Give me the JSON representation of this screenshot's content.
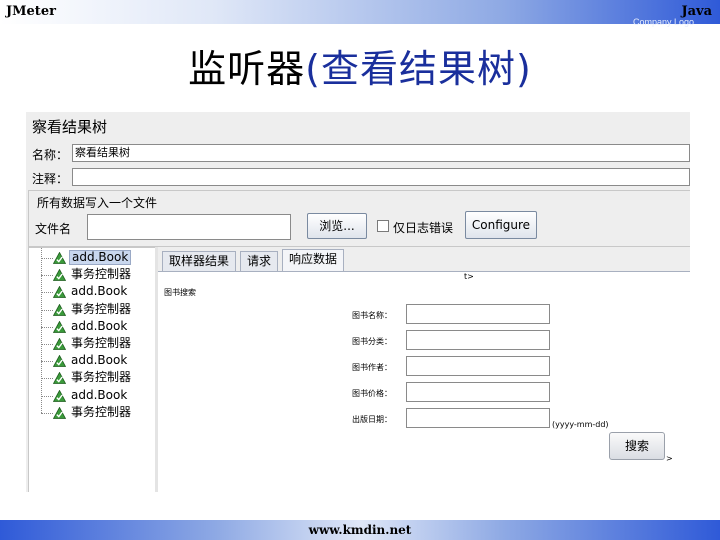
{
  "slide": {
    "header_left": "JMeter",
    "header_right": "Java",
    "header_logo": "Company Logo",
    "title_main": "监听器",
    "title_sub": "(查看结果树)",
    "footer": "www.kmdin.net"
  },
  "panel": {
    "title": "察看结果树",
    "name_label": "名称：",
    "name_value": "察看结果树",
    "comment_label": "注释：",
    "comment_value": "",
    "file_group_title": "所有数据写入一个文件",
    "filename_label": "文件名",
    "filename_value": "",
    "browse_button": "浏览...",
    "errors_only_label": "仅日志错误",
    "configure_button": "Configure"
  },
  "tree": {
    "items": [
      {
        "label": "add.Book",
        "selected": true
      },
      {
        "label": "事务控制器",
        "selected": false
      },
      {
        "label": "add.Book",
        "selected": false
      },
      {
        "label": "事务控制器",
        "selected": false
      },
      {
        "label": "add.Book",
        "selected": false
      },
      {
        "label": "事务控制器",
        "selected": false
      },
      {
        "label": "add.Book",
        "selected": false
      },
      {
        "label": "事务控制器",
        "selected": false
      },
      {
        "label": "add.Book",
        "selected": false
      },
      {
        "label": "事务控制器",
        "selected": false
      }
    ]
  },
  "tabs": [
    {
      "label": "取样器结果",
      "active": false
    },
    {
      "label": "请求",
      "active": false
    },
    {
      "label": "响应数据",
      "active": true
    }
  ],
  "response": {
    "fragment_top": "t>",
    "heading": "图书搜索",
    "name_label": "图书名称：",
    "category_label": "图书分类：",
    "author_label": "图书作者：",
    "price_label": "图书价格：",
    "date_label": "出版日期：",
    "date_hint": "(yyyy-mm-dd)",
    "search_button": "搜索",
    "fragment_right": ">"
  },
  "colors": {
    "accent_blue": "#2f5ad8",
    "title_blue": "#1a2f9c",
    "tree_selection": "#c9d7ee",
    "icon_green": "#3a9a3a"
  },
  "icons": {
    "tree_node": "sampler-check-icon",
    "checkbox": "checkbox-icon"
  }
}
